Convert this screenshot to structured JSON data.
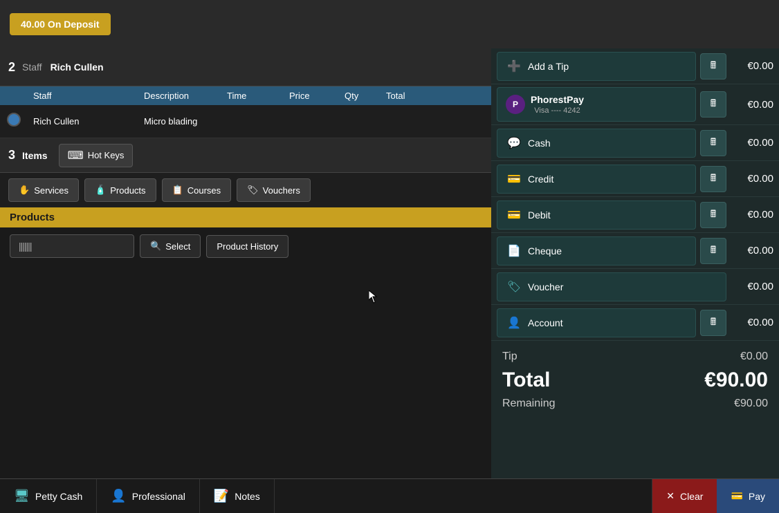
{
  "deposit": {
    "label": "40.00 On Deposit"
  },
  "staff_row": {
    "number": "2",
    "label": "Staff",
    "name": "Rich Cullen"
  },
  "table_headers": {
    "radio": "",
    "staff": "Staff",
    "description": "Description",
    "time": "Time",
    "price": "Price",
    "qty": "Qty",
    "total": "Total",
    "delete": "",
    "edit": ""
  },
  "table_rows": [
    {
      "staff": "Rich Cullen",
      "description": "Micro blading",
      "time": "",
      "price": "",
      "qty": "",
      "total": ""
    }
  ],
  "items_section": {
    "number": "3",
    "label": "Items",
    "hot_keys_label": "Hot Keys"
  },
  "category_tabs": [
    {
      "id": "services",
      "label": "Services",
      "icon": "✋"
    },
    {
      "id": "products",
      "label": "Products",
      "icon": "🧴"
    },
    {
      "id": "courses",
      "label": "Courses",
      "icon": "📋"
    },
    {
      "id": "vouchers",
      "label": "Vouchers",
      "icon": "🏷"
    }
  ],
  "products_section": {
    "header": "Products",
    "barcode_placeholder": "|||||||",
    "select_label": "Select",
    "product_history_label": "Product History"
  },
  "payment": {
    "add_tip_label": "Add a Tip",
    "phorest_pay_label": "PhorestPay",
    "phorest_pay_sub": "Visa ---- 4242",
    "cash_label": "Cash",
    "credit_label": "Credit",
    "debit_label": "Debit",
    "cheque_label": "Cheque",
    "voucher_label": "Voucher",
    "account_label": "Account",
    "amounts": {
      "tip": "€0.00",
      "phorest_pay": "€0.00",
      "cash": "€0.00",
      "credit": "€0.00",
      "debit": "€0.00",
      "cheque": "€0.00",
      "voucher": "€0.00",
      "account": "€0.00"
    }
  },
  "totals": {
    "tip_label": "Tip",
    "tip_value": "€0.00",
    "total_label": "Total",
    "total_value": "€90.00",
    "remaining_label": "Remaining",
    "remaining_value": "€90.00"
  },
  "bottom_bar": {
    "petty_cash_label": "Petty Cash",
    "professional_label": "Professional",
    "notes_label": "Notes",
    "clear_label": "Clear",
    "pay_label": "Pay"
  }
}
